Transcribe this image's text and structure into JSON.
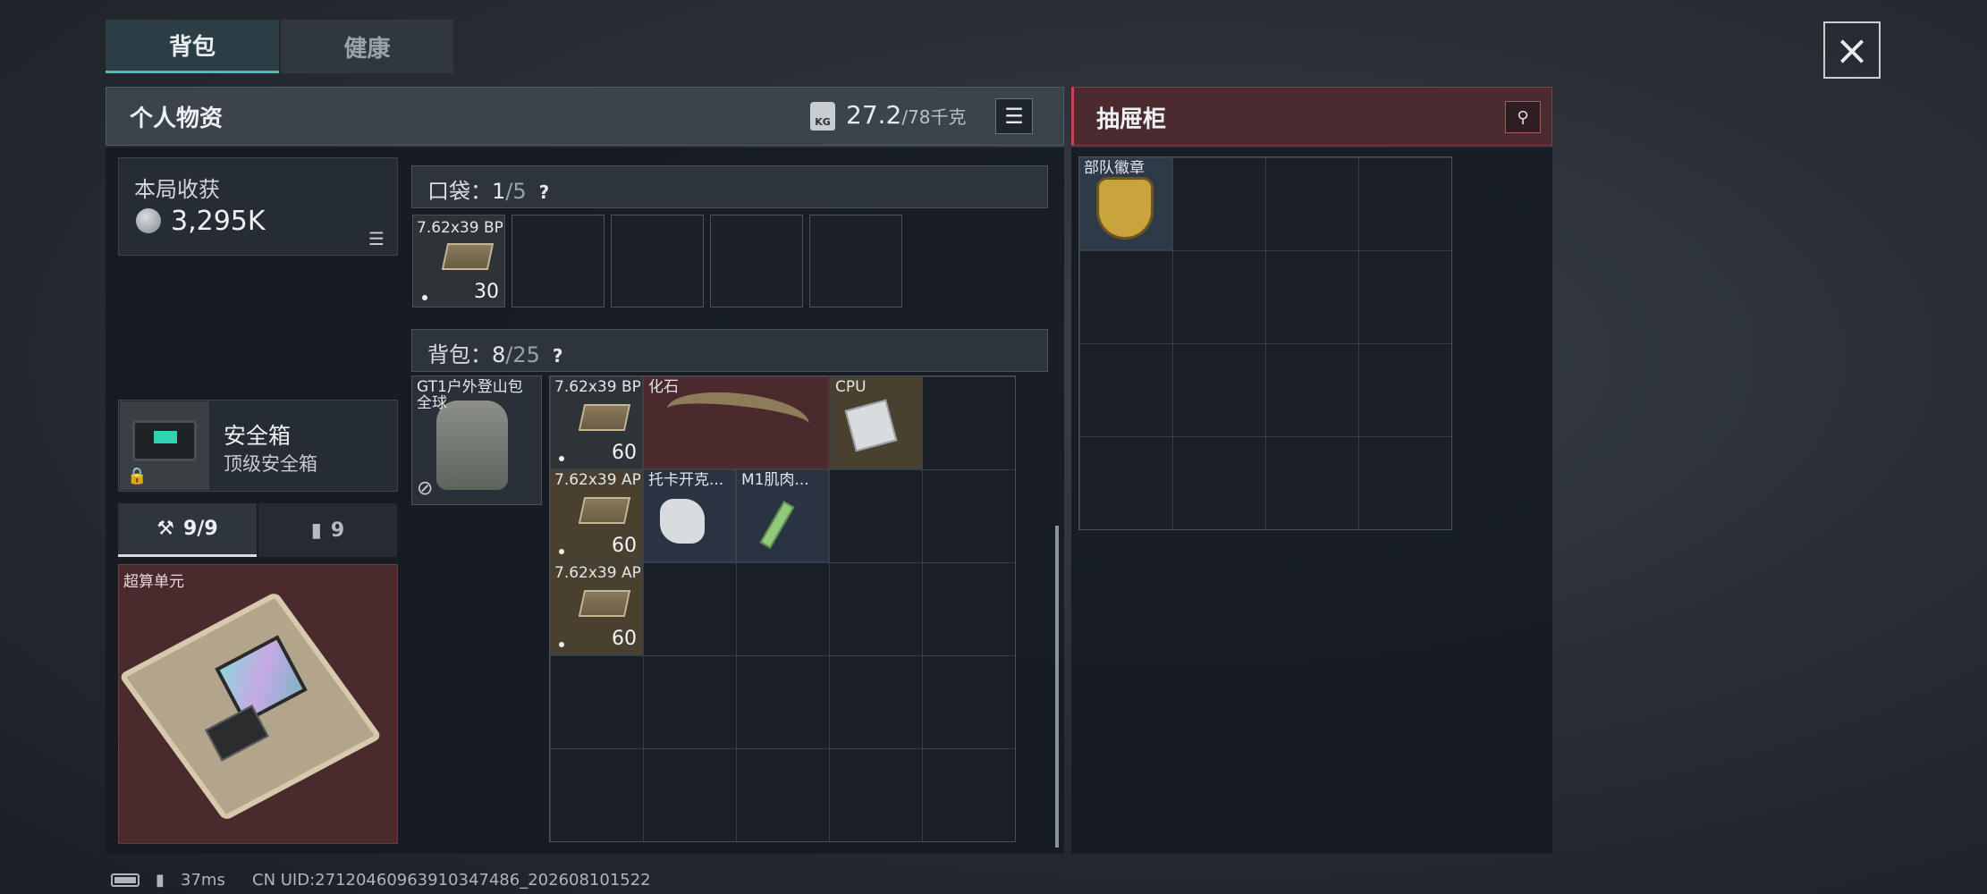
{
  "tabs": {
    "backpack": "背包",
    "health": "健康"
  },
  "close_icon": "×",
  "personal": {
    "title": "个人物资",
    "weight_current": "27.2",
    "weight_max": "/78千克",
    "kg_icon_text": "KG",
    "list_icon": "☰"
  },
  "drawer": {
    "title": "抽屉柜",
    "pin_icon": "⚲"
  },
  "loot": {
    "label": "本局收获",
    "value": "3,295K",
    "list_icon": "☰"
  },
  "safe": {
    "name": "安全箱",
    "sub": "顶级安全箱",
    "lock_icon": "🔒"
  },
  "subtabs": {
    "tab1": "9/9",
    "tab1_icon": "⚒",
    "tab2": "9",
    "tab2_icon": "▮"
  },
  "super_unit": {
    "label": "超算单元"
  },
  "pocket": {
    "label": "口袋：",
    "count": "1",
    "total": "/5",
    "help": "?"
  },
  "pocket_items": [
    {
      "name": "7.62x39 BP",
      "qty": "30"
    }
  ],
  "backpack": {
    "label": "背包：",
    "count": "8",
    "total": "/25",
    "help": "?"
  },
  "bag_equipped": {
    "name": "GT1户外登山包 全球",
    "icon": "⊘"
  },
  "bag_items": {
    "ammo_bp": {
      "name": "7.62x39 BP",
      "qty": "60"
    },
    "fossil": {
      "name": "化石"
    },
    "cpu": {
      "name": "CPU"
    },
    "ammo_ap1": {
      "name": "7.62x39 AP",
      "qty": "60"
    },
    "tokarev": {
      "name": "托卡开克..."
    },
    "m1": {
      "name": "M1肌肉..."
    },
    "ammo_ap2": {
      "name": "7.62x39 AP",
      "qty": "60"
    }
  },
  "drawer_items": [
    {
      "name": "部队徽章"
    }
  ],
  "status": {
    "ping": "37ms",
    "uid": "CN UID:27120460963910347486_202608101522"
  },
  "colors": {
    "accent": "#3fc4b7",
    "drawer_red": "#c8434f"
  }
}
